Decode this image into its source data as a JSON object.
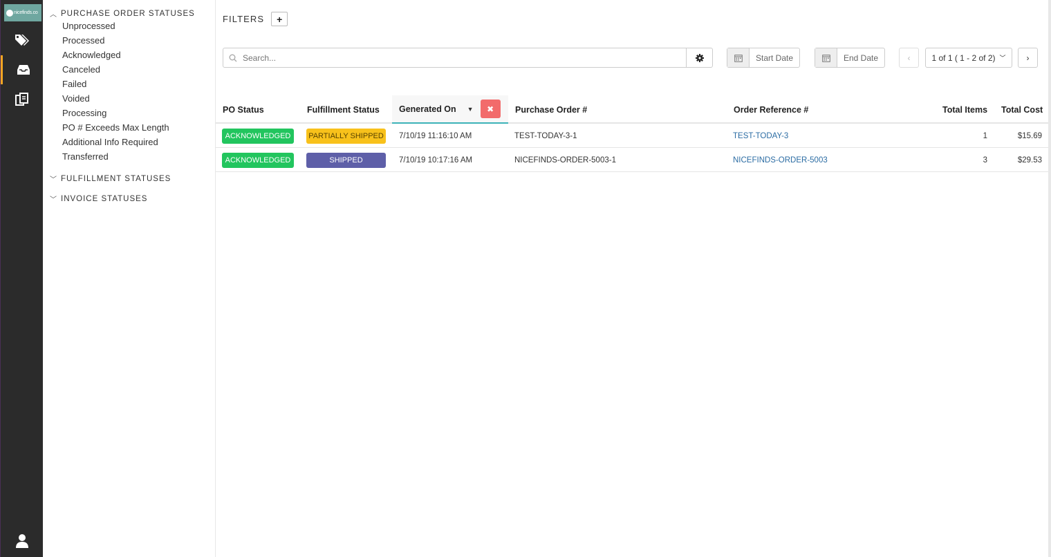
{
  "rail": {
    "logo_text": "nicefinds.co",
    "items": [
      {
        "icon": "tags-icon"
      },
      {
        "icon": "inbox-icon",
        "active": true
      },
      {
        "icon": "documents-icon"
      }
    ],
    "user_icon": "user-icon",
    "active_color": "#f5a623"
  },
  "sidebar": {
    "groups": [
      {
        "label": "PURCHASE ORDER STATUSES",
        "expanded": true,
        "items": [
          "Unprocessed",
          "Processed",
          "Acknowledged",
          "Canceled",
          "Failed",
          "Voided",
          "Processing",
          "PO # Exceeds Max Length",
          "Additional Info Required",
          "Transferred"
        ]
      },
      {
        "label": "FULFILLMENT STATUSES",
        "expanded": false
      },
      {
        "label": "INVOICE STATUSES",
        "expanded": false
      }
    ]
  },
  "filters": {
    "label": "FILTERS",
    "add_label": "+"
  },
  "search": {
    "placeholder": "Search..."
  },
  "dates": {
    "start_label": "Start Date",
    "end_label": "End Date"
  },
  "pagination": {
    "summary": "1 of 1 ( 1 - 2 of 2)",
    "prev": "‹",
    "next": "›"
  },
  "table": {
    "columns": [
      "PO Status",
      "Fulfillment Status",
      "Generated On",
      "Purchase Order #",
      "Order Reference #",
      "Total Items",
      "Total Cost"
    ],
    "sorted_column": "Generated On",
    "clear_sort_label": "✖",
    "rows": [
      {
        "po_status": "ACKNOWLEDGED",
        "fulfillment": "PARTIALLY SHIPPED",
        "fulfillment_color": "yellow",
        "generated": "7/10/19 11:16:10 AM",
        "po_number": "TEST-TODAY-3-1",
        "order_ref": "TEST-TODAY-3",
        "items": "1",
        "cost": "$15.69"
      },
      {
        "po_status": "ACKNOWLEDGED",
        "fulfillment": "SHIPPED",
        "fulfillment_color": "purple",
        "generated": "7/10/19 10:17:16 AM",
        "po_number": "NICEFINDS-ORDER-5003-1",
        "order_ref": "NICEFINDS-ORDER-5003",
        "items": "3",
        "cost": "$29.53"
      }
    ]
  },
  "colors": {
    "acknowledged": "#22c55e",
    "partially_shipped": "#f8c11b",
    "shipped": "#5e5fa8",
    "link": "#2b6ca3",
    "sort_accent": "#3bb2b8",
    "clear_sort": "#f26b6b"
  }
}
